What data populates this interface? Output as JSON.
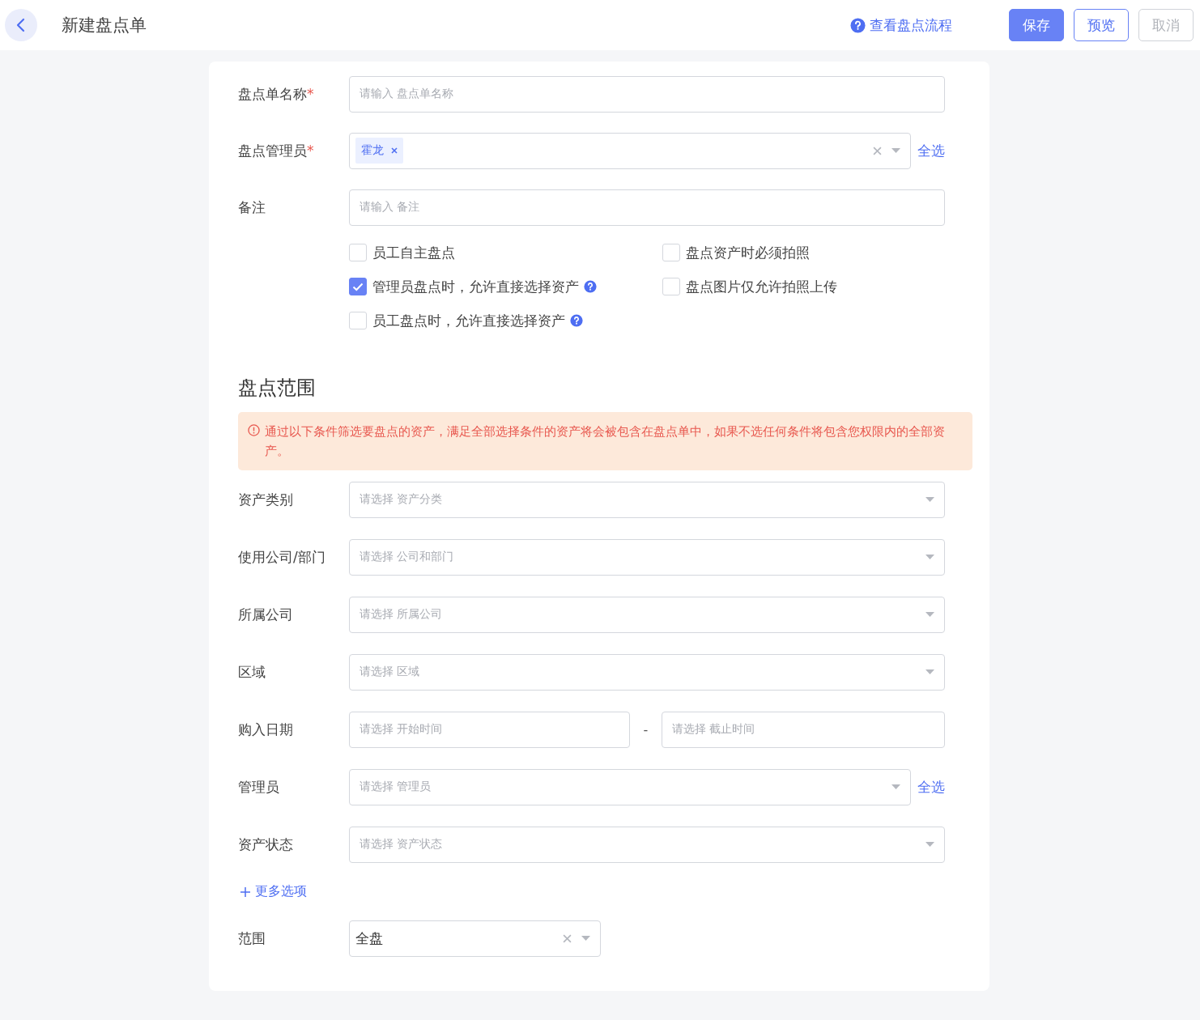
{
  "header": {
    "title": "新建盘点单",
    "help_link": "查看盘点流程",
    "buttons": [
      {
        "label": "保存",
        "kind": "primary"
      },
      {
        "label": "预览",
        "kind": "outline"
      },
      {
        "label": "取消",
        "kind": "disabled"
      }
    ]
  },
  "basic_fields": [
    {
      "label": "盘点单名称",
      "required_mark": "*",
      "kind": "text",
      "placeholder": "请输入 盘点单名称"
    },
    {
      "label": "盘点管理员",
      "required_mark": "*",
      "kind": "tags",
      "tags": [
        "霍龙"
      ],
      "select_all": "全选"
    },
    {
      "label": "备注",
      "kind": "text",
      "placeholder": "请输入 备注"
    }
  ],
  "options": [
    {
      "label": "员工自主盘点",
      "checked": false,
      "help": false
    },
    {
      "label": "盘点资产时必须拍照",
      "checked": false,
      "help": false
    },
    {
      "label": "管理员盘点时，允许直接选择资产",
      "checked": true,
      "help": true
    },
    {
      "label": "盘点图片仅允许拍照上传",
      "checked": false,
      "help": false
    },
    {
      "label": "员工盘点时，允许直接选择资产",
      "checked": false,
      "help": true
    }
  ],
  "scope": {
    "title": "盘点范围",
    "notice": "通过以下条件筛选要盘点的资产，满足全部选择条件的资产将会被包含在盘点单中，如果不选任何条件将包含您权限内的全部资产。",
    "fields": [
      {
        "label": "资产类别",
        "kind": "select",
        "placeholder": "请选择 资产分类"
      },
      {
        "label": "使用公司/部门",
        "kind": "select",
        "placeholder": "请选择 公司和部门"
      },
      {
        "label": "所属公司",
        "kind": "select",
        "placeholder": "请选择 所属公司"
      },
      {
        "label": "区域",
        "kind": "select",
        "placeholder": "请选择 区域"
      },
      {
        "label": "购入日期",
        "kind": "daterange",
        "start_placeholder": "请选择 开始时间",
        "separator": "-",
        "end_placeholder": "请选择 截止时间"
      },
      {
        "label": "管理员",
        "kind": "select",
        "placeholder": "请选择 管理员",
        "select_all": "全选"
      },
      {
        "label": "资产状态",
        "kind": "select",
        "placeholder": "请选择 资产状态"
      }
    ],
    "more_options": "更多选项",
    "range": {
      "label": "范围",
      "value": "全盘"
    }
  }
}
